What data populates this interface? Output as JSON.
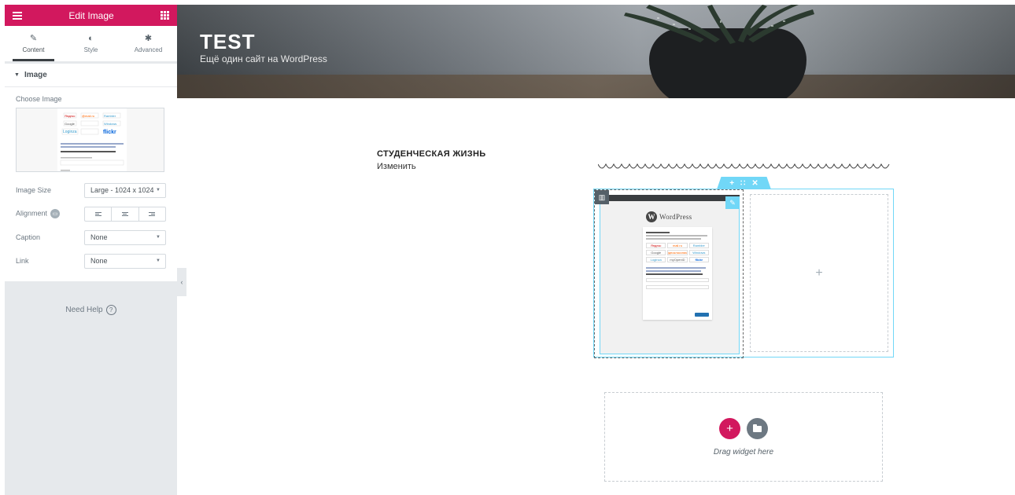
{
  "panel": {
    "header_title": "Edit Image",
    "tabs": [
      {
        "label": "Content",
        "icon": "pencil-icon"
      },
      {
        "label": "Style",
        "icon": "contrast-icon"
      },
      {
        "label": "Advanced",
        "icon": "gear-icon"
      }
    ],
    "section_title": "Image",
    "choose_image_label": "Choose Image",
    "controls": {
      "image_size": {
        "label": "Image Size",
        "value": "Large - 1024 x 1024"
      },
      "alignment": {
        "label": "Alignment"
      },
      "caption": {
        "label": "Caption",
        "value": "None"
      },
      "link": {
        "label": "Link",
        "value": "None"
      }
    },
    "need_help": "Need Help",
    "collapse_glyph": "‹"
  },
  "site": {
    "title": "TEST",
    "description": "Ещё один сайт на WordPress"
  },
  "post": {
    "title": "СТУДЕНЧЕСКАЯ ЖИЗНЬ",
    "edit_link": "Изменить"
  },
  "login_mock": {
    "logo_text": "WordPress",
    "providers": [
      "Яндекс",
      "mail.ru",
      "Rambler",
      "Google",
      "Одноклассники",
      "Windows",
      "Loginza",
      "myOpenID",
      "flickr"
    ]
  },
  "dropzone": {
    "text": "Drag widget here"
  },
  "colors": {
    "accent": "#d2185e",
    "editor_blue": "#71d7f7",
    "panel_bg": "#e6e9ec"
  }
}
